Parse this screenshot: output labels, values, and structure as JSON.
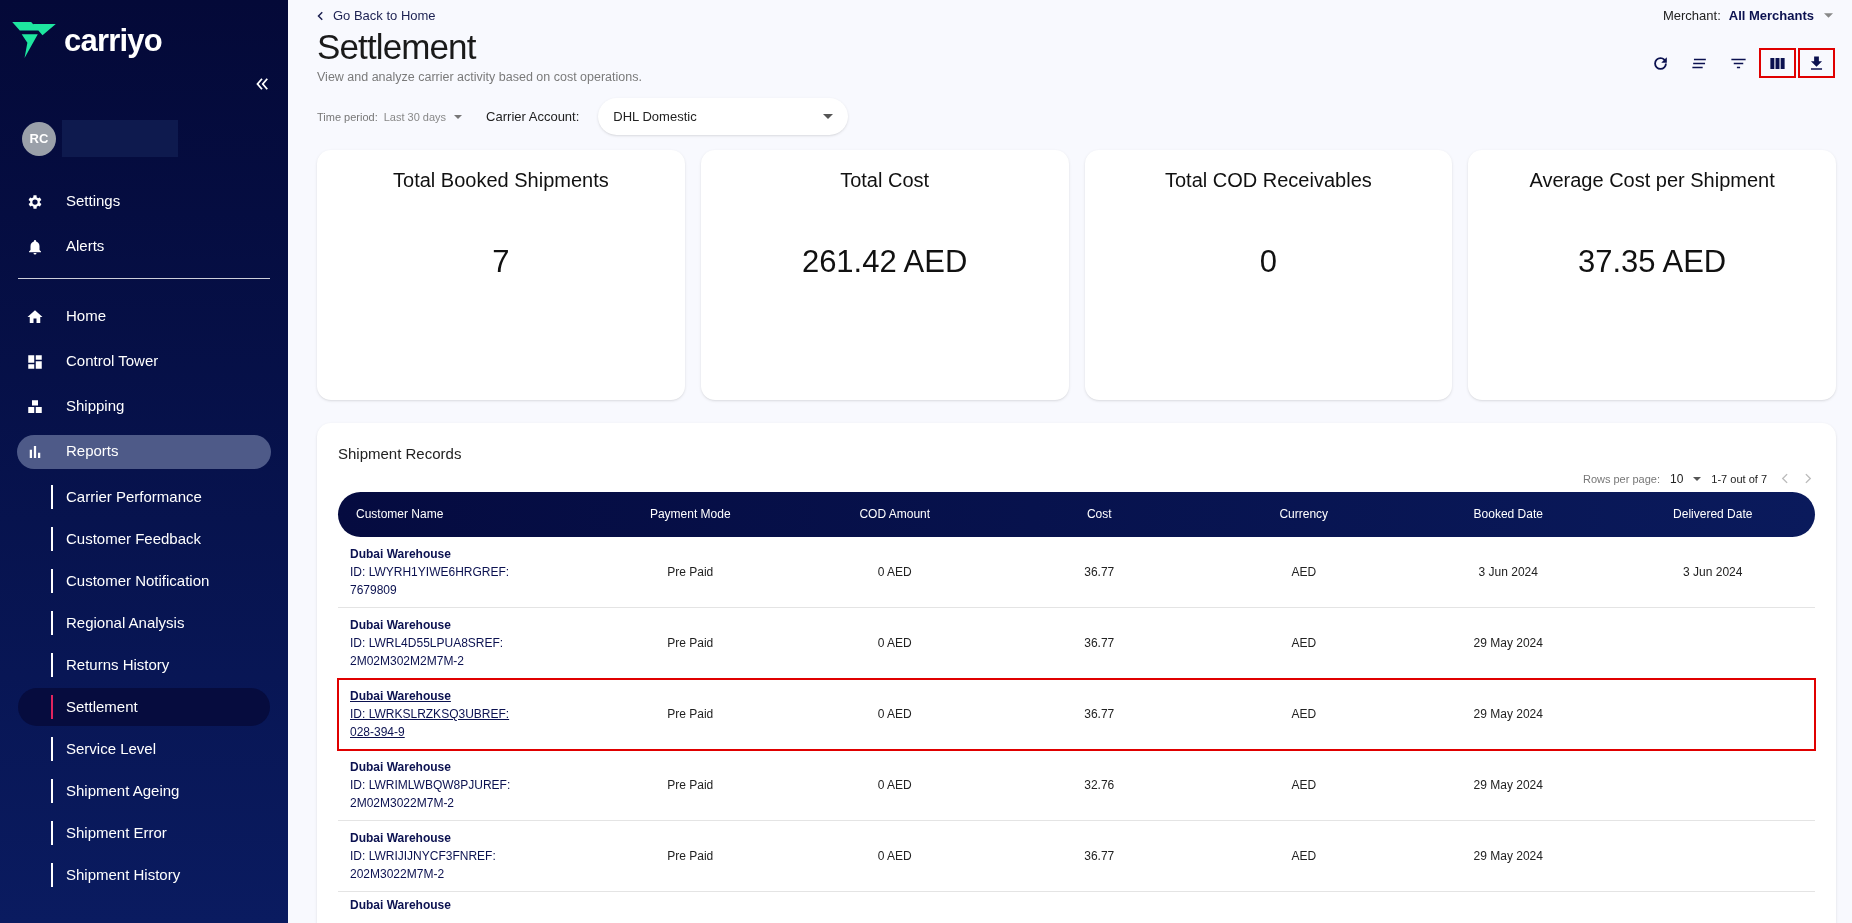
{
  "sidebar": {
    "logo": "carriyo",
    "avatar": "RC",
    "top_items": [
      {
        "label": "Settings",
        "kind": "settings"
      },
      {
        "label": "Alerts",
        "kind": "alerts"
      }
    ],
    "nav_items": [
      {
        "label": "Home",
        "kind": "home",
        "selected": false
      },
      {
        "label": "Control Tower",
        "kind": "dashboard",
        "selected": false
      },
      {
        "label": "Shipping",
        "kind": "shipping",
        "selected": false
      },
      {
        "label": "Reports",
        "kind": "reports",
        "selected": true
      }
    ],
    "sub_items": [
      {
        "label": "Carrier Performance",
        "selected": false
      },
      {
        "label": "Customer Feedback",
        "selected": false
      },
      {
        "label": "Customer Notification",
        "selected": false
      },
      {
        "label": "Regional Analysis",
        "selected": false
      },
      {
        "label": "Returns History",
        "selected": false
      },
      {
        "label": "Settlement",
        "selected": true
      },
      {
        "label": "Service Level",
        "selected": false
      },
      {
        "label": "Shipment Ageing",
        "selected": false
      },
      {
        "label": "Shipment Error",
        "selected": false
      },
      {
        "label": "Shipment History",
        "selected": false
      }
    ]
  },
  "header": {
    "back_link": "Go Back to Home",
    "title": "Settlement",
    "subtitle": "View and analyze carrier activity based on cost operations.",
    "merchant_label": "Merchant:",
    "merchant_value": "All Merchants",
    "toolbar": [
      {
        "kind": "refresh",
        "highlighted": false
      },
      {
        "kind": "density",
        "highlighted": false
      },
      {
        "kind": "filter",
        "highlighted": false
      },
      {
        "kind": "columns",
        "highlighted": true
      },
      {
        "kind": "download",
        "highlighted": true
      }
    ],
    "time_period_label": "Time period:",
    "time_period_value": "Last 30 days",
    "carrier_label": "Carrier Account:",
    "carrier_value": "DHL Domestic"
  },
  "stat_cards": [
    {
      "title": "Total Booked Shipments",
      "value": "7"
    },
    {
      "title": "Total Cost",
      "value": "261.42 AED"
    },
    {
      "title": "Total COD Receivables",
      "value": "0"
    },
    {
      "title": "Average Cost per Shipment",
      "value": "37.35 AED"
    }
  ],
  "table": {
    "title": "Shipment Records",
    "rows_per_page_label": "Rows per page:",
    "rows_per_page": "10",
    "range": "1-7 out of 7",
    "columns": [
      "Customer Name",
      "Payment Mode",
      "COD Amount",
      "Cost",
      "Currency",
      "Booked Date",
      "Delivered Date"
    ],
    "rows": [
      {
        "customer": "Dubai Warehouse",
        "id": "ID: LWYRH1YIWE6HRGREF: 7679809",
        "payment_mode": "Pre Paid",
        "cod_amount": "0 AED",
        "cost": "36.77",
        "currency": "AED",
        "booked_date": "3 Jun 2024",
        "delivered_date": "3 Jun 2024",
        "highlighted": false
      },
      {
        "customer": "Dubai Warehouse",
        "id": "ID: LWRL4D55LPUA8SREF: 2M02M302M2M7M-2",
        "payment_mode": "Pre Paid",
        "cod_amount": "0 AED",
        "cost": "36.77",
        "currency": "AED",
        "booked_date": "29 May 2024",
        "highlighted": false
      },
      {
        "customer": "Dubai Warehouse",
        "id": "ID: LWRKSLRZKSQ3UBREF: 028-394-9",
        "payment_mode": "Pre Paid",
        "cod_amount": "0 AED",
        "cost": "36.77",
        "currency": "AED",
        "booked_date": "29 May 2024",
        "highlighted": true
      },
      {
        "customer": "Dubai Warehouse",
        "id": "ID: LWRIMLWBQW8PJUREF: 2M02M3022M7M-2",
        "payment_mode": "Pre Paid",
        "cod_amount": "0 AED",
        "cost": "32.76",
        "currency": "AED",
        "booked_date": "29 May 2024",
        "highlighted": false
      },
      {
        "customer": "Dubai Warehouse",
        "id": "ID: LWRIJIJNYCF3FNREF: 202M3022M7M-2",
        "payment_mode": "Pre Paid",
        "cod_amount": "0 AED",
        "cost": "36.77",
        "currency": "AED",
        "booked_date": "29 May 2024",
        "highlighted": false
      },
      {
        "customer": "Dubai Warehouse",
        "highlighted": false
      }
    ]
  }
}
